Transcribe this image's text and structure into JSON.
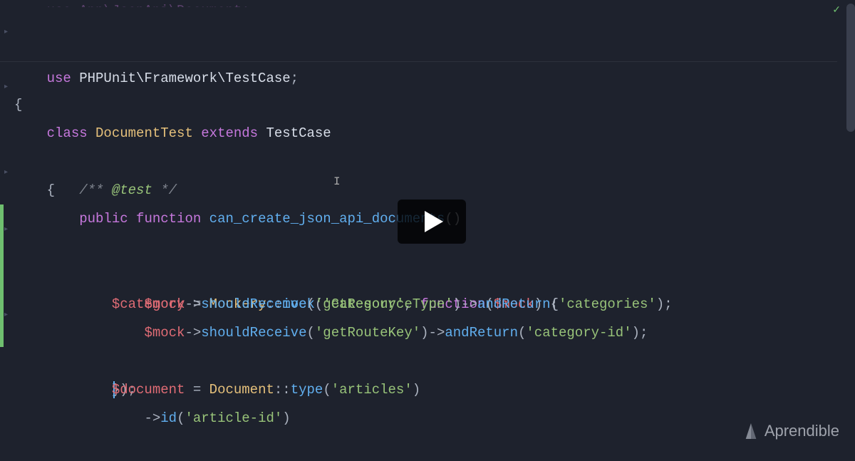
{
  "code": {
    "line0": "use App\\JsonApi\\Document;",
    "line1_use": "use ",
    "line1_ns": "PHPUnit\\Framework\\TestCase",
    "semicolon": ";",
    "class_kw": "class ",
    "class_name": "DocumentTest",
    "extends_kw": " extends ",
    "base_class": "TestCase",
    "open_brace": "{",
    "close_brace": "}",
    "doc_open": "/** ",
    "doc_tag": "@test",
    "doc_close": " */",
    "public_kw": "public ",
    "function_kw": "function ",
    "fn_name": "can_create_json_api_documents",
    "parens": "()",
    "indent1": "    ",
    "indent2": "        ",
    "indent3": "            ",
    "var_cat": "$category",
    "eq": " = ",
    "mockery": "Mockery",
    "dcolon": "::",
    "mock": "mock",
    "open_p": "(",
    "close_p": ")",
    "str_category": "'Category'",
    "comma_sp": ", ",
    "func_kw": "function",
    "var_mock": "$mock",
    "close_p_brace": ") {",
    "arrow": "->",
    "shouldReceive": "shouldReceive",
    "andReturn": "andReturn",
    "str_getResourceType": "'getResourceType'",
    "str_categories": "'categories'",
    "str_getRouteKey": "'getRouteKey'",
    "str_categoryId": "'category-id'",
    "close_anon": "});",
    "var_doc": "$document",
    "Document": "Document",
    "type_fn": "type",
    "str_articles": "'articles'",
    "id_fn": "id",
    "str_articleId": "'article-id'"
  },
  "watermark": "Aprendible",
  "icons": {
    "play": "play-icon",
    "check": "check-icon",
    "logo": "aprendible-logo"
  }
}
